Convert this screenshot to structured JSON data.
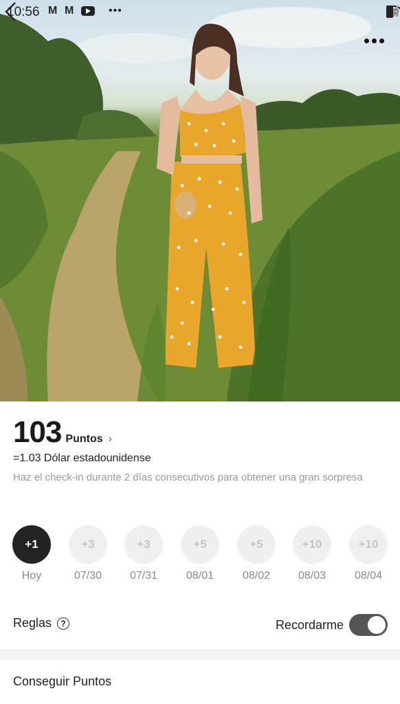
{
  "status_bar": {
    "time": "10:56",
    "icons": [
      "gmail-icon",
      "gmail-icon",
      "youtube-icon",
      "more-dots-icon",
      "wifi-icon",
      "signal-icon",
      "battery-icon"
    ]
  },
  "header": {
    "back_icon": "chevron-left-icon",
    "more_icon": "more-dots-icon"
  },
  "points": {
    "value": "103",
    "unit": "Puntos",
    "chevron": "›",
    "equivalent": "=1.03 Dólar estadounidense",
    "hint": "Haz el check-in durante 2 días consecutivos para obtener una gran sorpresa"
  },
  "checkin_days": [
    {
      "reward": "+1",
      "label": "Hoy",
      "active": true
    },
    {
      "reward": "+3",
      "label": "07/30",
      "active": false
    },
    {
      "reward": "+3",
      "label": "07/31",
      "active": false
    },
    {
      "reward": "+5",
      "label": "08/01",
      "active": false
    },
    {
      "reward": "+5",
      "label": "08/02",
      "active": false
    },
    {
      "reward": "+10",
      "label": "08/03",
      "active": false
    },
    {
      "reward": "+10",
      "label": "08/04",
      "active": false
    }
  ],
  "rules": {
    "label": "Reglas",
    "help_glyph": "?"
  },
  "reminder": {
    "label": "Recordarme",
    "enabled": true
  },
  "earn_points": {
    "title": "Conseguir Puntos"
  },
  "colors": {
    "active_day": "#222222",
    "inactive_day": "#f0f0f0",
    "toggle_on": "#555555",
    "dress": "#e8a72a"
  }
}
